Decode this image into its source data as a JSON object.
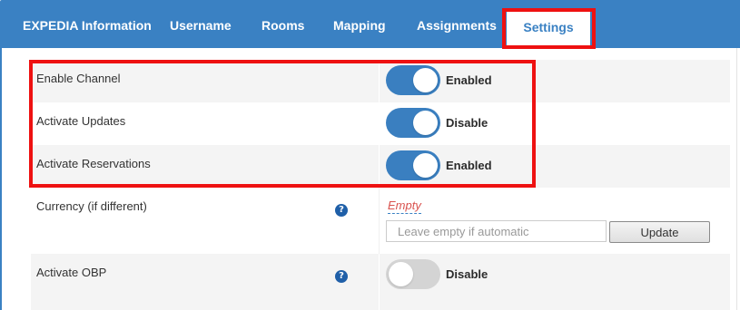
{
  "tabs": [
    {
      "label": "EXPEDIA Information"
    },
    {
      "label": "Username"
    },
    {
      "label": "Rooms"
    },
    {
      "label": "Mapping"
    },
    {
      "label": "Assignments"
    },
    {
      "label": "Settings",
      "active": true
    }
  ],
  "settings": {
    "enable_channel": {
      "label": "Enable Channel",
      "state": "Enabled",
      "on": true
    },
    "activate_updates": {
      "label": "Activate Updates",
      "state": "Disable",
      "on": true
    },
    "activate_reservations": {
      "label": "Activate Reservations",
      "state": "Enabled",
      "on": true
    },
    "currency": {
      "label": "Currency (if different)",
      "help": "?",
      "value_text": "Empty",
      "input_value": "",
      "input_placeholder": "Leave empty if automatic",
      "button_label": "Update"
    },
    "activate_obp": {
      "label": "Activate OBP",
      "help": "?",
      "state": "Disable",
      "on": false
    }
  },
  "colors": {
    "tab_bar": "#3a81c3",
    "toggle_on": "#3a7fc0",
    "toggle_off": "#d4d4d4",
    "highlight": "#ee1111",
    "empty_text": "#d9534f",
    "help_icon": "#1f5fa8"
  }
}
